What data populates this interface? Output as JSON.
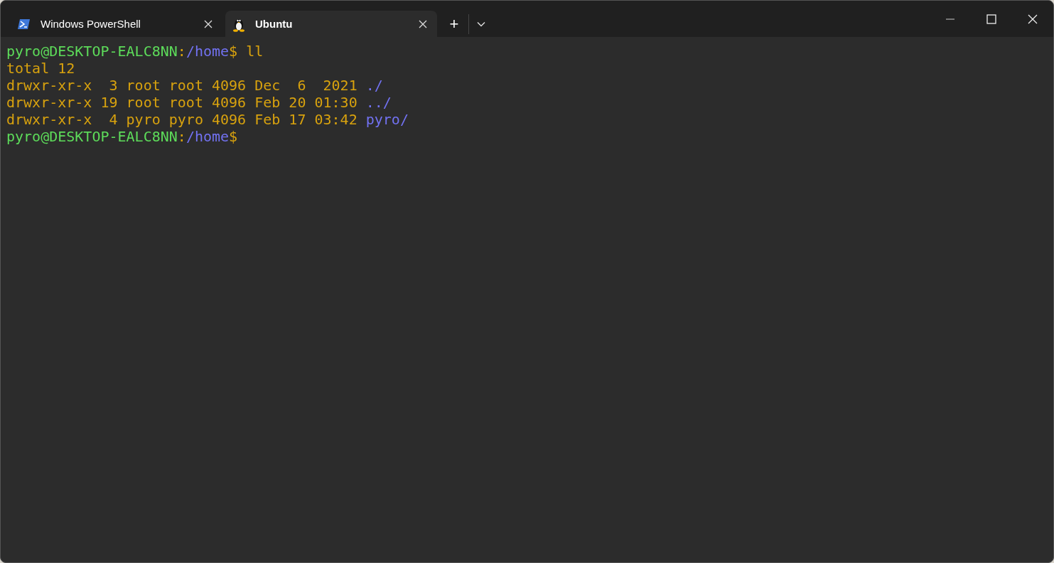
{
  "tabs": [
    {
      "label": "Windows PowerShell",
      "kind": "powershell",
      "selected": false
    },
    {
      "label": "Ubuntu",
      "kind": "linux",
      "selected": true
    }
  ],
  "new_tab": "+",
  "terminal": {
    "lines": [
      [
        {
          "kind": "prompt",
          "text": "pyro@DESKTOP-EALC8NN"
        },
        {
          "kind": "plain",
          "text": ":"
        },
        {
          "kind": "path",
          "text": "/home"
        },
        {
          "kind": "plain",
          "text": "$ ll"
        }
      ],
      [
        {
          "kind": "plain",
          "text": "total 12"
        }
      ],
      [
        {
          "kind": "plain",
          "text": "drwxr-xr-x  3 root root 4096 Dec  6  2021 "
        },
        {
          "kind": "path",
          "text": "./"
        }
      ],
      [
        {
          "kind": "plain",
          "text": "drwxr-xr-x 19 root root 4096 Feb 20 01:30 "
        },
        {
          "kind": "path",
          "text": "../"
        }
      ],
      [
        {
          "kind": "plain",
          "text": "drwxr-xr-x  4 pyro pyro 4096 Feb 17 03:42 "
        },
        {
          "kind": "path",
          "text": "pyro/"
        }
      ],
      [
        {
          "kind": "prompt",
          "text": "pyro@DESKTOP-EALC8NN"
        },
        {
          "kind": "plain",
          "text": ":"
        },
        {
          "kind": "path",
          "text": "/home"
        },
        {
          "kind": "plain",
          "text": "$"
        }
      ]
    ]
  }
}
